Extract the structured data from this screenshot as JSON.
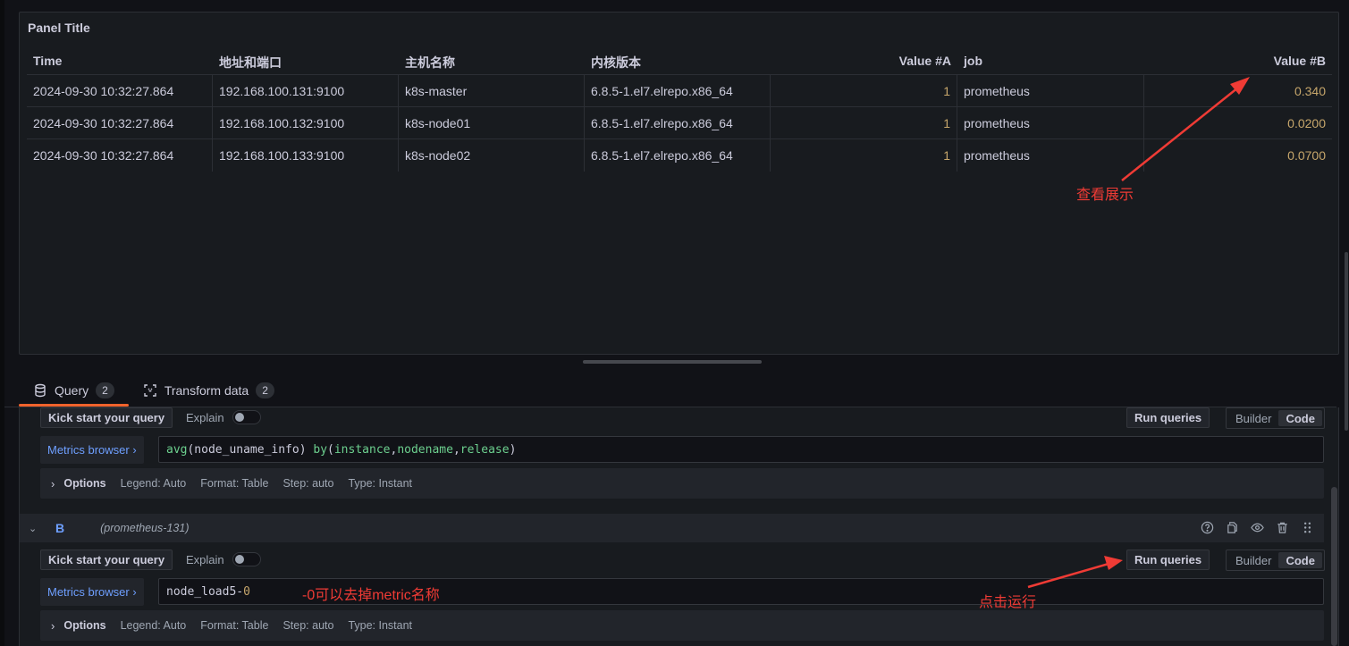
{
  "panel": {
    "title": "Panel Title",
    "table": {
      "columns": [
        "Time",
        "地址和端口",
        "主机名称",
        "内核版本",
        "Value #A",
        "job",
        "Value #B"
      ],
      "rows": [
        [
          "2024-09-30 10:32:27.864",
          "192.168.100.131:9100",
          "k8s-master",
          "6.8.5-1.el7.elrepo.x86_64",
          "1",
          "prometheus",
          "0.340"
        ],
        [
          "2024-09-30 10:32:27.864",
          "192.168.100.132:9100",
          "k8s-node01",
          "6.8.5-1.el7.elrepo.x86_64",
          "1",
          "prometheus",
          "0.0200"
        ],
        [
          "2024-09-30 10:32:27.864",
          "192.168.100.133:9100",
          "k8s-node02",
          "6.8.5-1.el7.elrepo.x86_64",
          "1",
          "prometheus",
          "0.0700"
        ]
      ]
    }
  },
  "tabs": [
    {
      "label": "Query",
      "count": "2",
      "icon": "database-icon",
      "active": true
    },
    {
      "label": "Transform data",
      "count": "2",
      "icon": "transform-icon",
      "active": false
    }
  ],
  "queries": [
    {
      "kick_start_label": "Kick start your query",
      "explain_label": "Explain",
      "explain_on": false,
      "run_label": "Run queries",
      "mode_options": [
        "Builder",
        "Code"
      ],
      "mode_selected": "Code",
      "metrics_browser_label": "Metrics browser ›",
      "expr_tokens": [
        {
          "t": "avg",
          "c": "fn"
        },
        {
          "t": "(node_uname_info) ",
          "c": ""
        },
        {
          "t": "by",
          "c": "kw"
        },
        {
          "t": "(",
          "c": ""
        },
        {
          "t": "instance",
          "c": "kw"
        },
        {
          "t": ",",
          "c": ""
        },
        {
          "t": "nodename",
          "c": "kw"
        },
        {
          "t": ",",
          "c": ""
        },
        {
          "t": "release",
          "c": "kw"
        },
        {
          "t": ")",
          "c": ""
        }
      ],
      "options": {
        "label": "Options",
        "legend": "Legend: Auto",
        "format": "Format: Table",
        "step": "Step: auto",
        "type": "Type: Instant"
      }
    },
    {
      "ref_id": "B",
      "datasource": "(prometheus-131)",
      "header_actions": [
        "help-icon",
        "duplicate-icon",
        "eye-icon",
        "trash-icon",
        "drag-handle-icon"
      ],
      "kick_start_label": "Kick start your query",
      "explain_label": "Explain",
      "explain_on": false,
      "run_label": "Run queries",
      "mode_options": [
        "Builder",
        "Code"
      ],
      "mode_selected": "Code",
      "metrics_browser_label": "Metrics browser ›",
      "expr_tokens": [
        {
          "t": "node_load5-",
          "c": ""
        },
        {
          "t": "0",
          "c": "num"
        }
      ],
      "options": {
        "label": "Options",
        "legend": "Legend: Auto",
        "format": "Format: Table",
        "step": "Step: auto",
        "type": "Type: Instant"
      }
    }
  ],
  "annotations": {
    "view_display": "查看展示",
    "remove_metric_name": "-0可以去掉metric名称",
    "click_run": "点击运行",
    "color": "#ef3b35"
  }
}
